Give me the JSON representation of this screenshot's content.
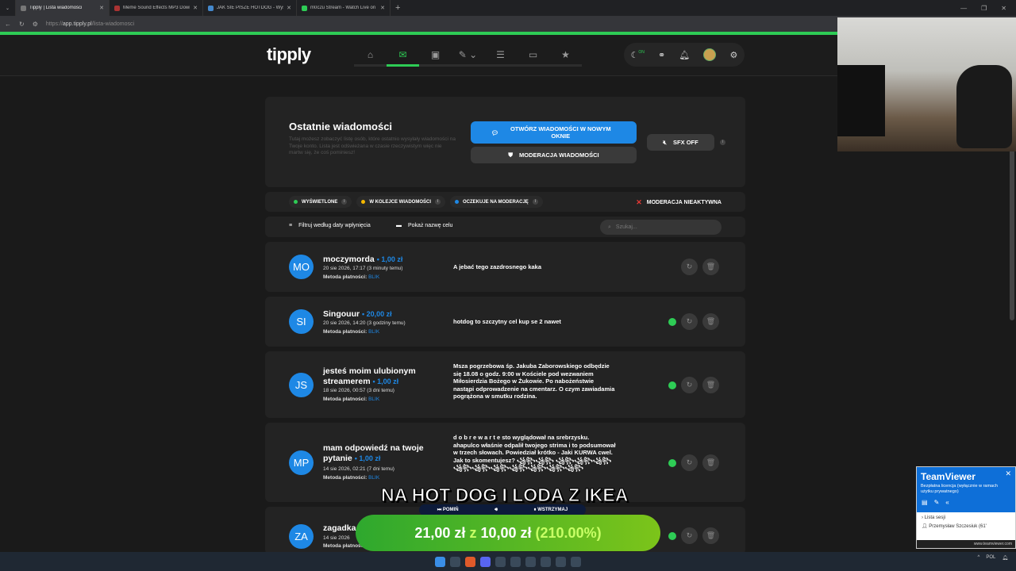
{
  "browser": {
    "tabs": [
      {
        "title": "Tipply | Lista wiadomości",
        "active": true
      },
      {
        "title": "Meme Sound Effects MP3 Downlo",
        "active": false
      },
      {
        "title": "JAK SIE PISZE HOTDOG - Wyszukaj",
        "active": false
      },
      {
        "title": "m0c2u Stream - Watch Live on Ki",
        "active": false
      }
    ],
    "new_tab": "+",
    "url_prefix": "https://",
    "url_host": "app.tipply.pl",
    "url_path": "/lista-wiadomosci"
  },
  "header": {
    "logo": "tipply",
    "nav_icons": [
      "home-icon",
      "inbox-icon",
      "wallet-icon",
      "edit-icon",
      "layers-icon",
      "window-icon",
      "star-icon"
    ],
    "on_label": "ON"
  },
  "messages_panel": {
    "title": "Ostatnie wiadomości",
    "description": "Tutaj możesz zobaczyć listę osób, które ostatnio wysyłały wiadomości na Twoje konto. Lista jest odświeżana w czasie rzeczywistym więc nie martw się, że coś pominiesz!",
    "open_button": "OTWÓRZ WIADOMOŚCI W NOWYM OKNIE",
    "moderation_button": "MODERACJA WIADOMOŚCI",
    "sfx_button": "SFX OFF"
  },
  "status": {
    "displayed": "WYŚWIETLONE",
    "queued": "W KOLEJCE WIADOMOŚCI",
    "pending": "OCZEKUJE NA MODERACJĘ",
    "moderation_inactive": "MODERACJA NIEAKTYWNA",
    "colors": {
      "displayed": "#2ecc55",
      "queued": "#f5b800",
      "pending": "#1e88e5"
    }
  },
  "filters": {
    "filter_label": "Filtruj według daty wpłynięcia",
    "show_label": "Pokaż nazwę celu",
    "search_placeholder": "Szukaj..."
  },
  "messages": [
    {
      "initials": "MO",
      "name": "moczymorda",
      "amount": "1,00 zł",
      "date": "20 sie 2026, 17:17 (3 minuty temu)",
      "payment_label": "Metoda płatności:",
      "payment": "BLIK",
      "text": "A jebać tego zazdrosnego kaka"
    },
    {
      "initials": "SI",
      "name": "Singouur",
      "amount": "20,00 zł",
      "date": "20 sie 2026, 14:20 (3 godziny temu)",
      "payment_label": "Metoda płatności:",
      "payment": "BLIK",
      "text": "hotdog to szczytny cel kup se 2 nawet"
    },
    {
      "initials": "JS",
      "name": "jesteś moim ulubionym streamerem",
      "amount": "1,00 zł",
      "date": "18 sie 2026, 00:57 (3 dni temu)",
      "payment_label": "Metoda płatności:",
      "payment": "BLIK",
      "text": "Msza pogrzebowa śp. Jakuba Zaborowskiego odbędzie się 18.08 o godz. 9:00 w Kościele pod wezwaniem Miłosierdzia Bożego w Żukowie. Po nabożeństwie nastąpi odprowadzenie na cmentarz. O czym zawiadamia pogrążona w smutku rodzina."
    },
    {
      "initials": "MP",
      "name": "mam odpowiedź na twoje pytanie",
      "amount": "1,00 zł",
      "date": "14 sie 2026, 02:21 (7 dni temu)",
      "payment_label": "Metoda płatności:",
      "payment": "BLIK",
      "text": "d o b r e w a r t e sto wyglądował na srebrzysku. ahapulco właśnie odpalił twojego strima i to podsumował w trzech słowach. Powiedział krótko - Jaki KURWA cwel. Jak to skomentujesz? ꧁꧂꧁꧂ ꧁꧂꧁꧂꧁꧂꧁꧂꧁꧂꧁꧂꧁꧂꧁꧂꧁꧂꧁꧂"
    },
    {
      "initials": "ZA",
      "name": "zagadka",
      "amount": "",
      "date": "14 sie 2026",
      "payment_label": "Metoda płatności:",
      "payment": "",
      "text": ""
    }
  ],
  "overlays": {
    "alert_text": "NA HOT DOG I LODA Z IKEA",
    "skip": "POMIŃ",
    "pause": "WSTRZYMAJ",
    "goal_current": "21,00 zł",
    "goal_sep": "z",
    "goal_target": "10,00 zł",
    "goal_percent": "(210.00%)"
  },
  "teamviewer": {
    "title": "TeamViewer",
    "subtitle": "Bezpłatna licencja (wyłącznie w ramach użytku prywatnego)",
    "sessions": "Lista sesji",
    "user": "Przemysław Szczesiuk (61'",
    "footer": "www.teamviewer.com"
  },
  "tray": {
    "lang": "POL"
  }
}
